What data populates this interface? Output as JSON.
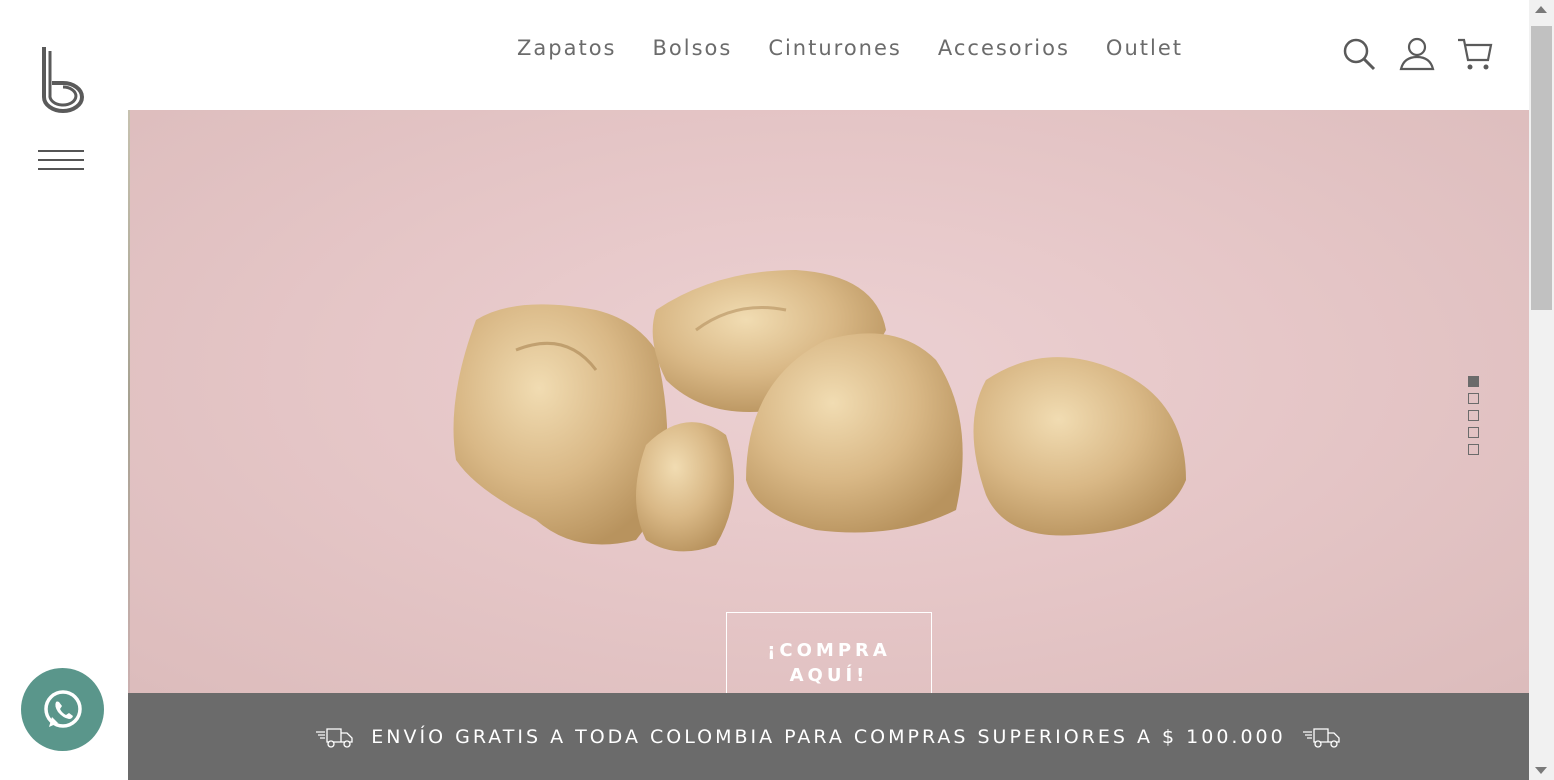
{
  "nav": {
    "items": [
      {
        "label": "Zapatos"
      },
      {
        "label": "Bolsos"
      },
      {
        "label": "Cinturones"
      },
      {
        "label": "Accesorios"
      },
      {
        "label": "Outlet"
      }
    ]
  },
  "header_icons": [
    "search-icon",
    "user-icon",
    "cart-icon"
  ],
  "hero": {
    "cta_line1": "¡COMPRA",
    "cta_line2": "AQUÍ!",
    "slides_count": 5,
    "active_slide": 1
  },
  "banner": {
    "text": "ENVÍO GRATIS A TODA COLOMBIA PARA COMPRAS SUPERIORES A $ 100.000"
  },
  "colors": {
    "hero_bg": "#e6c7c8",
    "banner_bg": "#6b6b6b",
    "whatsapp": "#5a968b",
    "nav_text": "#6b6b6b"
  }
}
